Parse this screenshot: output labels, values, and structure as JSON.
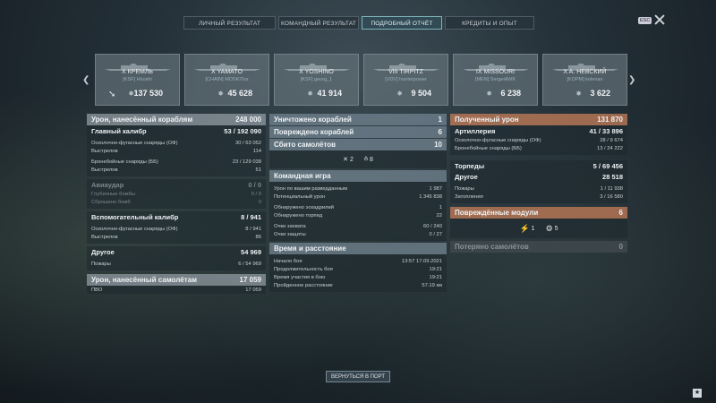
{
  "tabs": [
    {
      "label": "ЛИЧНЫЙ РЕЗУЛЬТАТ"
    },
    {
      "label": "КОМАНДНЫЙ РЕЗУЛЬТАТ"
    },
    {
      "label": "ПОДРОБНЫЙ ОТЧЁТ"
    },
    {
      "label": "КРЕДИТЫ И ОПЫТ"
    }
  ],
  "esc_label": "ESC",
  "ships": [
    {
      "name": "X КРЕМЛЬ",
      "player": "[KSF] Hiroshi",
      "value": "137 530"
    },
    {
      "name": "X YAMATO",
      "player": "[CHAIN] MOSKITos",
      "value": "45 628"
    },
    {
      "name": "X YOSHINO",
      "player": "[KSF] georg_1",
      "value": "41 914"
    },
    {
      "name": "VIII TIRPITZ",
      "player": "[VDV] hunterpower",
      "value": "9 504"
    },
    {
      "name": "IX MISSOURI",
      "player": "[MEN] SergeiAWK",
      "value": "6 238"
    },
    {
      "name": "X A. НЕВСКИЙ",
      "player": "[KOPM] kolenan",
      "value": "3 622"
    }
  ],
  "left": {
    "header": {
      "label": "Урон, нанесённый кораблям",
      "value": "248 000"
    },
    "main_caliber": {
      "label": "Главный калибр",
      "value": "53 / 192 090"
    },
    "mc_he": {
      "label": "Осколочно-фугасные снаряды (ОФ)",
      "value": "30 / 63 052"
    },
    "mc_he_shots": {
      "label": "Выстрелов",
      "value": "114"
    },
    "mc_ap": {
      "label": "Бронебойные снаряды (ББ)",
      "value": "23 / 129 038"
    },
    "mc_ap_shots": {
      "label": "Выстрелов",
      "value": "51"
    },
    "airstrike": {
      "label": "Авиаудар",
      "value": "0 / 0"
    },
    "depth": {
      "label": "Глубинные бомбы",
      "value": "0 / 0"
    },
    "dropped": {
      "label": "Сброшено бомб",
      "value": "0"
    },
    "secondary": {
      "label": "Вспомогательный калибр",
      "value": "8 / 941"
    },
    "sec_he": {
      "label": "Осколочно-фугасные снаряды (ОФ)",
      "value": "8 / 941"
    },
    "sec_shots": {
      "label": "Выстрелов",
      "value": "86"
    },
    "other": {
      "label": "Другое",
      "value": "54 969"
    },
    "fires": {
      "label": "Пожары",
      "value": "6 / 54 969"
    },
    "planes_header": {
      "label": "Урон, нанесённый самолётам",
      "value": "17 059"
    },
    "aa": {
      "label": "ПВО",
      "value": "17 059"
    }
  },
  "middle": {
    "destroyed": {
      "label": "Уничтожено кораблей",
      "value": "1"
    },
    "damaged": {
      "label": "Повреждено кораблей",
      "value": "6"
    },
    "planes": {
      "label": "Сбито самолётов",
      "value": "10"
    },
    "icon_a": "2",
    "icon_b": "8",
    "team_header": "Командная игра",
    "spotting": {
      "label": "Урон по вашим разведданным",
      "value": "1 987"
    },
    "potential": {
      "label": "Потенциальный урон",
      "value": "1 345 838"
    },
    "squadrons": {
      "label": "Обнаружено эскадрилий",
      "value": "1"
    },
    "torpedoes": {
      "label": "Обнаружено торпед",
      "value": "22"
    },
    "capture": {
      "label": "Очки захвата",
      "value": "60 / 240"
    },
    "defense": {
      "label": "Очки защиты",
      "value": "0 / 27"
    },
    "time_header": "Время и расстояние",
    "start": {
      "label": "Начало боя",
      "value": "13:57  17.09.2021"
    },
    "duration": {
      "label": "Продолжительность боя",
      "value": "19:21"
    },
    "participation": {
      "label": "Время участия в бою",
      "value": "19:21"
    },
    "distance": {
      "label": "Пройденное расстояние",
      "value": "57.19 км"
    }
  },
  "right": {
    "header": {
      "label": "Полученный урон",
      "value": "131 870"
    },
    "artillery": {
      "label": "Артиллерия",
      "value": "41 / 33 896"
    },
    "art_he": {
      "label": "Осколочно-фугасные снаряды (ОФ)",
      "value": "28 / 9 674"
    },
    "art_ap": {
      "label": "Бронебойные снаряды (ББ)",
      "value": "13 / 24 222"
    },
    "torps": {
      "label": "Торпеды",
      "value": "5 / 69 456"
    },
    "other": {
      "label": "Другое",
      "value": "28 518"
    },
    "fires": {
      "label": "Пожары",
      "value": "1 / 11 938"
    },
    "flooding": {
      "label": "Затопления",
      "value": "3 / 16 580"
    },
    "modules_header": {
      "label": "Повреждённые модули",
      "value": "6"
    },
    "mod_a": "1",
    "mod_b": "5",
    "lost_planes": {
      "label": "Потеряно самолётов",
      "value": "0"
    }
  },
  "footer": {
    "back_button": "ВЕРНУТЬСЯ В ПОРТ"
  },
  "colors": {
    "accent": "#7fb3b7",
    "received_header": "#b97855"
  }
}
